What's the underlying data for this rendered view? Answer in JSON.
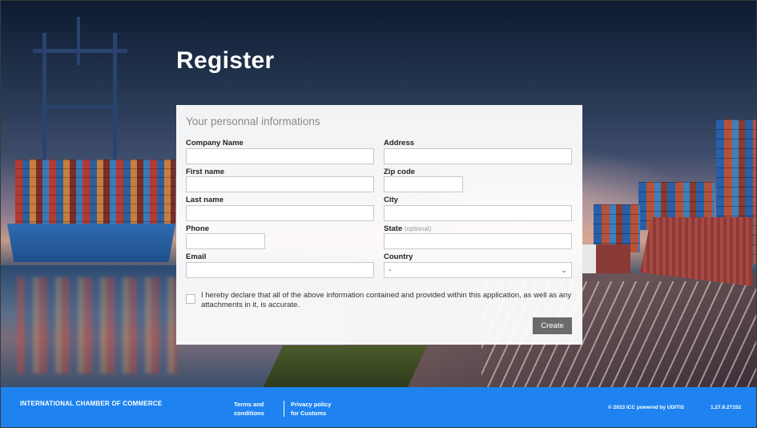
{
  "page": {
    "title": "Register"
  },
  "form": {
    "heading": "Your personnal informations",
    "fields": {
      "company_name": {
        "label": "Company Name",
        "value": ""
      },
      "first_name": {
        "label": "First name",
        "value": ""
      },
      "last_name": {
        "label": "Last name",
        "value": ""
      },
      "phone": {
        "label": "Phone",
        "value": ""
      },
      "email": {
        "label": "Email",
        "value": ""
      },
      "address": {
        "label": "Address",
        "value": ""
      },
      "zip_code": {
        "label": "Zip code",
        "value": ""
      },
      "city": {
        "label": "City",
        "value": ""
      },
      "state": {
        "label": "State",
        "optional_text": "(optional)",
        "value": ""
      },
      "country": {
        "label": "Country",
        "selected": "-"
      }
    },
    "declaration": "I hereby declare that all of the above information contained and provided within this application, as well as any attachments in it, is accurate.",
    "declaration_checked": false,
    "submit_label": "Create"
  },
  "footer": {
    "organization": "INTERNATIONAL CHAMBER OF COMMERCE",
    "terms": [
      "Terms and",
      "conditions"
    ],
    "privacy": [
      "Privacy policy",
      "for Customs"
    ],
    "copyright": "© 2023 ICC powered by UDITIS",
    "version": "1.27.8.27152",
    "background_color": "#1e83f0"
  }
}
